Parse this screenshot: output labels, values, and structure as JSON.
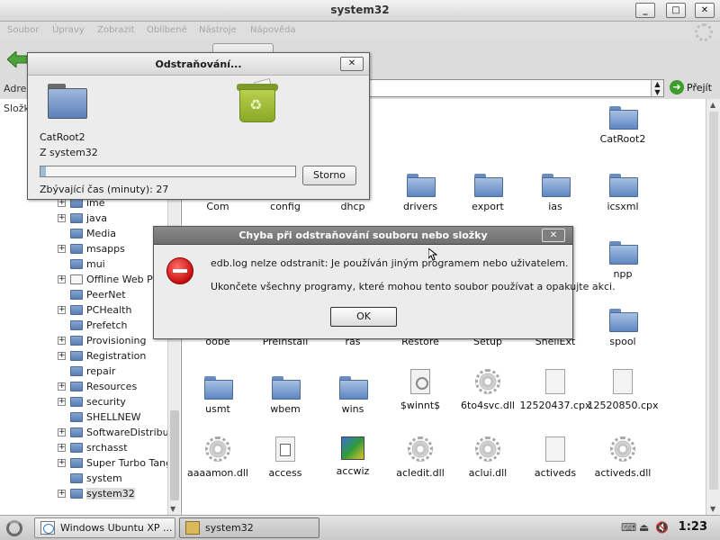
{
  "window": {
    "title": "system32",
    "minimize": "_",
    "maximize": "□",
    "close": "✕"
  },
  "menu": {
    "items": [
      "Soubor",
      "Úpravy",
      "Zobrazit",
      "Oblíbené",
      "Nástroje",
      "Nápověda"
    ]
  },
  "address": {
    "label": "Adres",
    "go_label": "Přejít",
    "go_icon": "go-arrow-icon",
    "dropdown_icon": "chevron-down-icon"
  },
  "left_pane": {
    "header": "Složk",
    "items": [
      {
        "label": "ime",
        "expand": "+",
        "icon": "folder-icon"
      },
      {
        "label": "java",
        "expand": "+",
        "icon": "folder-icon"
      },
      {
        "label": "Media",
        "expand": "",
        "icon": "folder-icon"
      },
      {
        "label": "msapps",
        "expand": "+",
        "icon": "folder-icon"
      },
      {
        "label": "mui",
        "expand": "",
        "icon": "folder-icon"
      },
      {
        "label": "Offline Web Pa",
        "expand": "+",
        "icon": "offline-folder-icon"
      },
      {
        "label": "PeerNet",
        "expand": "",
        "icon": "folder-icon"
      },
      {
        "label": "PCHealth",
        "expand": "+",
        "icon": "folder-icon"
      },
      {
        "label": "Prefetch",
        "expand": "",
        "icon": "folder-icon"
      },
      {
        "label": "Provisioning",
        "expand": "+",
        "icon": "folder-icon"
      },
      {
        "label": "Registration",
        "expand": "+",
        "icon": "folder-icon"
      },
      {
        "label": "repair",
        "expand": "",
        "icon": "folder-icon"
      },
      {
        "label": "Resources",
        "expand": "+",
        "icon": "folder-icon"
      },
      {
        "label": "security",
        "expand": "+",
        "icon": "folder-icon"
      },
      {
        "label": "SHELLNEW",
        "expand": "",
        "icon": "folder-icon"
      },
      {
        "label": "SoftwareDistributi",
        "expand": "+",
        "icon": "folder-icon"
      },
      {
        "label": "srchasst",
        "expand": "+",
        "icon": "folder-icon"
      },
      {
        "label": "Super Turbo Tang",
        "expand": "+",
        "icon": "folder-icon"
      },
      {
        "label": "system",
        "expand": "",
        "icon": "folder-icon"
      },
      {
        "label": "system32",
        "expand": "+",
        "icon": "folder-icon",
        "selected": true
      }
    ]
  },
  "files": {
    "row0": [
      {
        "label": "CatRoot2",
        "icon": "folder-icon"
      }
    ],
    "row1": [
      {
        "label": "Com",
        "icon": "folder-icon"
      },
      {
        "label": "config",
        "icon": "folder-icon"
      },
      {
        "label": "dhcp",
        "icon": "folder-icon"
      },
      {
        "label": "drivers",
        "icon": "folder-icon"
      },
      {
        "label": "export",
        "icon": "folder-icon"
      },
      {
        "label": "ias",
        "icon": "folder-icon"
      },
      {
        "label": "icsxml",
        "icon": "folder-icon"
      }
    ],
    "row2": [
      {
        "label": "npp",
        "icon": "folder-icon"
      }
    ],
    "row3": [
      {
        "label": "oobe",
        "icon": "folder-icon"
      },
      {
        "label": "PreInstall",
        "icon": "folder-icon"
      },
      {
        "label": "ras",
        "icon": "folder-icon"
      },
      {
        "label": "Restore",
        "icon": "folder-icon"
      },
      {
        "label": "Setup",
        "icon": "folder-icon"
      },
      {
        "label": "ShellExt",
        "icon": "folder-icon"
      },
      {
        "label": "spool",
        "icon": "folder-icon"
      }
    ],
    "row4": [
      {
        "label": "usmt",
        "icon": "folder-icon"
      },
      {
        "label": "wbem",
        "icon": "folder-icon"
      },
      {
        "label": "wins",
        "icon": "folder-icon"
      },
      {
        "label": "$winnt$",
        "icon": "settings-file-icon"
      },
      {
        "label": "6to4svc.dll",
        "icon": "gear-icon"
      },
      {
        "label": "12520437.cpx",
        "icon": "document-icon"
      },
      {
        "label": "12520850.cpx",
        "icon": "document-icon"
      }
    ],
    "row5": [
      {
        "label": "aaaamon.dll",
        "icon": "gear-icon"
      },
      {
        "label": "access",
        "icon": "shortcut-doc-icon"
      },
      {
        "label": "accwiz",
        "icon": "wizard-icon"
      },
      {
        "label": "acledit.dll",
        "icon": "gear-icon"
      },
      {
        "label": "aclui.dll",
        "icon": "gear-icon"
      },
      {
        "label": "activeds",
        "icon": "document-icon"
      },
      {
        "label": "activeds.dll",
        "icon": "gear-icon"
      }
    ]
  },
  "progress_dialog": {
    "title": "Odstraňování...",
    "close": "✕",
    "item_name": "CatRoot2",
    "source": "Z system32",
    "progress": 0.02,
    "cancel_label": "Storno",
    "time_remaining": "Zbývající čas (minuty): 27",
    "source_icon": "folder-icon",
    "target_icon": "recycle-bin-icon"
  },
  "error_dialog": {
    "title": "Chyba při odstraňování souboru nebo složky",
    "close": "✕",
    "message1": "edb.log nelze odstranit: Je používán jiným programem nebo uživatelem.",
    "message2": "Ukončete všechny programy, které mohou tento soubor používat a opakujte akci.",
    "ok_label": "OK",
    "icon": "error-icon"
  },
  "taskbar": {
    "tasks": [
      {
        "label": "Windows Ubuntu XP ...",
        "icon": "browser-icon",
        "active": false
      },
      {
        "label": "system32",
        "icon": "explorer-icon",
        "active": true
      }
    ],
    "clock": "1:23",
    "tray_icons": [
      "network-icon",
      "eject-icon",
      "volume-muted-icon"
    ]
  },
  "colors": {
    "error_title_bar": "#7a7a7a",
    "error_icon": "#d11a1a",
    "recycle_bin": "#a3bf3a",
    "folder": "#6f94cb"
  }
}
